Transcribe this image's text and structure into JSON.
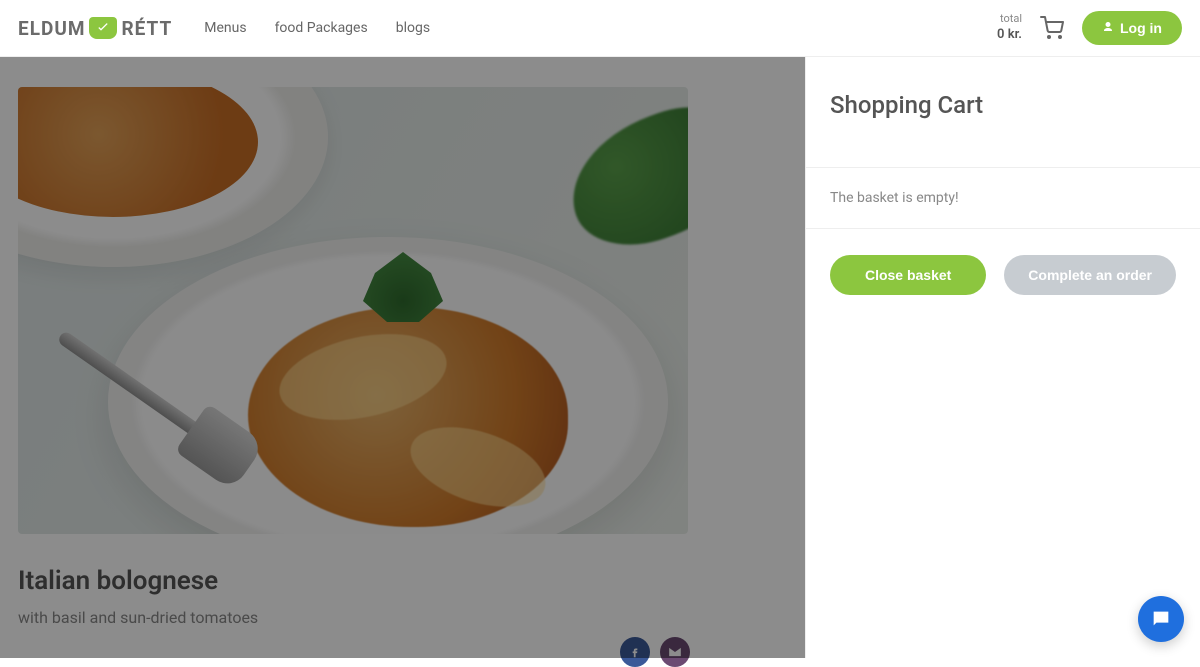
{
  "brand": {
    "part1": "ELDUM",
    "part2": "RÉTT"
  },
  "nav": {
    "menus": "Menus",
    "packages": "food Packages",
    "blogs": "blogs"
  },
  "header": {
    "total_label": "total",
    "total_amount": "0 kr.",
    "login": "Log in"
  },
  "dish": {
    "title": "Italian bolognese",
    "subtitle": "with basil and sun-dried tomatoes"
  },
  "cart": {
    "title": "Shopping Cart",
    "empty": "The basket is empty!",
    "close": "Close basket",
    "complete": "Complete an order"
  }
}
